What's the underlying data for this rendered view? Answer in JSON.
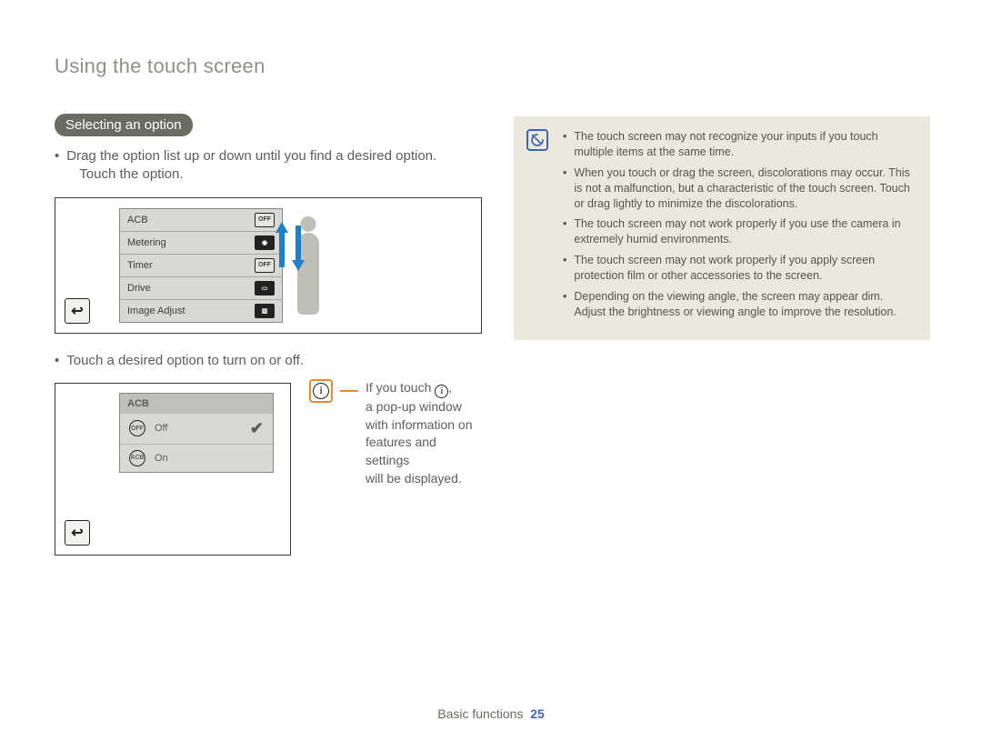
{
  "title": "Using the touch screen",
  "section_badge": "Selecting an option",
  "intro1": "Drag the option list up or down until you find a desired option.",
  "intro1_sub": "Touch the option.",
  "intro2": "Touch a desired option to turn on or off.",
  "fig1_rows": {
    "r0": "ACB",
    "r1": "Metering",
    "r2": "Timer",
    "r3": "Drive",
    "r4": "Image Adjust"
  },
  "fig2": {
    "header": "ACB",
    "off": "Off",
    "on": "On"
  },
  "callout": {
    "line1_pre": "If you touch ",
    "line1_post": ",",
    "line2": "a pop-up window",
    "line3": "with information on",
    "line4": "features and settings",
    "line5": "will be displayed."
  },
  "info_items": {
    "i0": "The touch screen may not recognize your inputs if you touch multiple items at the same time.",
    "i1": "When you touch or drag the screen, discolorations may occur. This is not a malfunction, but a characteristic of the touch screen. Touch or drag lightly to minimize the discolorations.",
    "i2": "The touch screen may not work properly if you use the camera in extremely humid environments.",
    "i3": "The touch screen may not work properly if you apply screen protection film or other accessories to the screen.",
    "i4": "Depending on the viewing angle, the screen may appear dim. Adjust the brightness or viewing angle to improve the resolution."
  },
  "footer_label": "Basic functions",
  "footer_page": "25"
}
